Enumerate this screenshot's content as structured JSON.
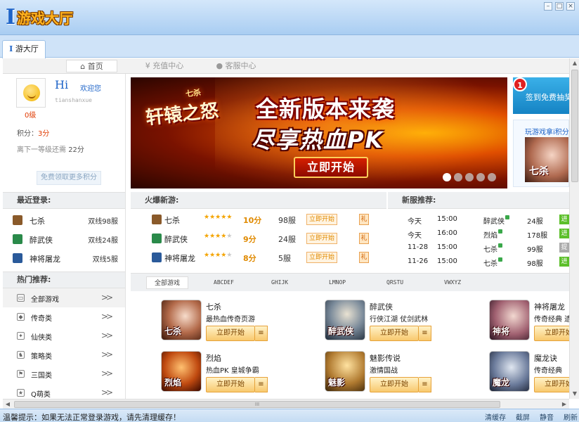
{
  "window": {
    "logo_mark": "I",
    "logo_word": "游戏大厅",
    "controls": [
      "–",
      "□",
      "×"
    ]
  },
  "tab": {
    "mark": "I",
    "label": "游大厅"
  },
  "nav": {
    "home": "首页",
    "recharge": "充值中心",
    "service": "客服中心",
    "home_icon": "house-icon",
    "recharge_icon": "yen-icon",
    "service_icon": "user-icon"
  },
  "user": {
    "level": "0级",
    "hi": "Hi",
    "welcome": "欢迎您",
    "username": "tianshanxue",
    "points_label": "积分：",
    "points_value": "3分",
    "next_label": "离下一等级还需",
    "next_value": "22分",
    "free_button": "免费领取更多积分"
  },
  "recent": {
    "title": "最近登录:",
    "items": [
      {
        "name": "七杀",
        "server": "双线98服",
        "color": "#8a5a2a"
      },
      {
        "name": "醉武侠",
        "server": "双线24服",
        "color": "#2a8a4a"
      },
      {
        "name": "神将屠龙",
        "server": "双线5服",
        "color": "#2a5a9a"
      }
    ]
  },
  "hot_categories": {
    "title": "热门推荐:",
    "items": [
      {
        "name": "全部游戏",
        "arrow": ">>"
      },
      {
        "name": "传奇类",
        "arrow": ">>"
      },
      {
        "name": "仙侠类",
        "arrow": ">>"
      },
      {
        "name": "策略类",
        "arrow": ">>"
      },
      {
        "name": "三国类",
        "arrow": ">>"
      },
      {
        "name": "Q萌类",
        "arrow": ">>"
      }
    ]
  },
  "banner": {
    "game_logo": "轩辕之怒",
    "game_logo_small": "七杀",
    "headline1": "全新版本来袭",
    "headline2": "尽享热血PK",
    "cta": "立即开始",
    "slide_count": 5,
    "active_slide": 1
  },
  "signin": {
    "badge": "1",
    "text": "签到免费抽奖"
  },
  "promo": {
    "caption": "玩游戏拿i积分",
    "art_text": "七杀"
  },
  "hot_new": {
    "title": "火爆新游:",
    "play_label": "立即开始",
    "gift_label": "礼",
    "items": [
      {
        "name": "七杀",
        "rating": 5,
        "score": "10分",
        "server": "98服",
        "color": "#8a5a2a"
      },
      {
        "name": "醉武侠",
        "rating": 4,
        "score": "9分",
        "server": "24服",
        "color": "#2a8a4a"
      },
      {
        "name": "神将屠龙",
        "rating": 4,
        "score": "8分",
        "server": "5服",
        "color": "#2a5a9a"
      }
    ]
  },
  "new_servers": {
    "title": "新服推荐:",
    "items": [
      {
        "day": "今天",
        "time": "15:00",
        "game": "醉武侠",
        "server": "24服",
        "tag": "进",
        "closed": false
      },
      {
        "day": "今天",
        "time": "16:00",
        "game": "烈焰",
        "server": "178服",
        "tag": "进",
        "closed": false
      },
      {
        "day": "11-28",
        "time": "15:00",
        "game": "七杀",
        "server": "99服",
        "tag": "提",
        "closed": true
      },
      {
        "day": "11-26",
        "time": "15:00",
        "game": "七杀",
        "server": "98服",
        "tag": "进",
        "closed": false
      }
    ]
  },
  "alpha_tabs": [
    "全部游戏",
    "ABCDEF",
    "GHIJK",
    "LMNOP",
    "QRSTU",
    "VWXYZ"
  ],
  "games": {
    "play_label": "立即开始",
    "menu_icon": "≡",
    "items": [
      {
        "title": "七杀",
        "desc": "最热血传奇页游",
        "thumb": "七杀"
      },
      {
        "title": "醉武侠",
        "desc": "行侠江湖 仗剑武林",
        "thumb": "醉武侠"
      },
      {
        "title": "神将屠龙",
        "desc": "传奇经典 遗",
        "thumb": "神将"
      },
      {
        "title": "烈焰",
        "desc": "热血PK 皇城争霸",
        "thumb": "烈焰"
      },
      {
        "title": "魅影传说",
        "desc": "激情国战",
        "thumb": "魅影"
      },
      {
        "title": "魔龙诀",
        "desc": "传奇经典",
        "thumb": "魔龙"
      }
    ]
  },
  "scroll": {
    "h_grip": "III"
  },
  "status": {
    "tip": "温馨提示：如果无法正常登录游戏，请先清理缓存！",
    "tools": [
      "清缓存",
      "截屏",
      "静音",
      "刷新"
    ]
  },
  "colors": {
    "accent_blue": "#1e64c8",
    "accent_orange": "#e08a00",
    "level_red": "#e03a00",
    "server_green": "#5cbf2a"
  }
}
